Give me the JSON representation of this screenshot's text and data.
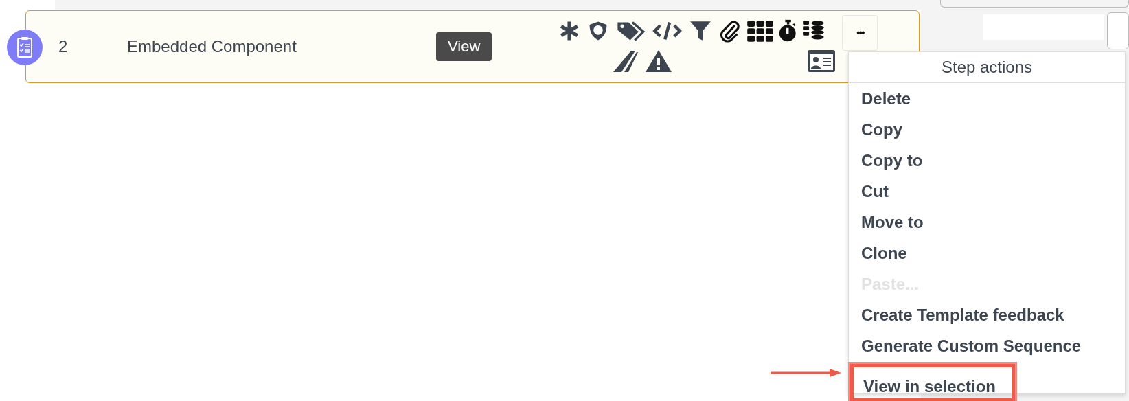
{
  "step": {
    "number": "2",
    "name": "Embedded Component",
    "view_button": "View",
    "more_button": "•••"
  },
  "menu": {
    "title": "Step actions",
    "items": [
      {
        "label": "Delete",
        "disabled": false,
        "highlighted": false
      },
      {
        "label": "Copy",
        "disabled": false,
        "highlighted": false
      },
      {
        "label": "Copy to",
        "disabled": false,
        "highlighted": false
      },
      {
        "label": "Cut",
        "disabled": false,
        "highlighted": false
      },
      {
        "label": "Move to",
        "disabled": false,
        "highlighted": false
      },
      {
        "label": "Clone",
        "disabled": false,
        "highlighted": false
      },
      {
        "label": "Paste...",
        "disabled": true,
        "highlighted": false
      },
      {
        "label": "Create Template feedback",
        "disabled": false,
        "highlighted": false
      },
      {
        "label": "Generate Custom Sequence",
        "disabled": false,
        "highlighted": false
      },
      {
        "label": "View in selection",
        "disabled": false,
        "highlighted": true
      }
    ]
  }
}
